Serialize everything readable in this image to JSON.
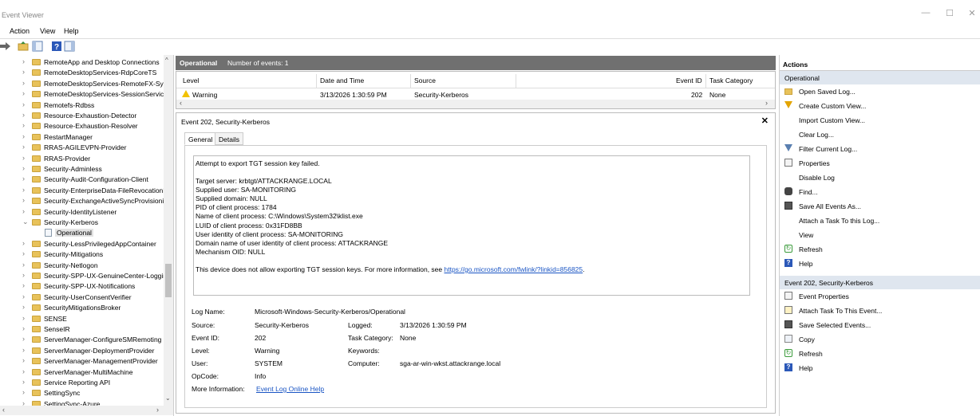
{
  "window": {
    "title": "Event Viewer",
    "minimize": "—",
    "maximize": "☐",
    "close": "✕"
  },
  "menu": {
    "items": [
      "Action",
      "View",
      "Help"
    ]
  },
  "tree": {
    "items": [
      {
        "label": "RemoteApp and Desktop Connections",
        "chev": "›"
      },
      {
        "label": "RemoteDesktopServices-RdpCoreTS",
        "chev": "›"
      },
      {
        "label": "RemoteDesktopServices-RemoteFX-Synth",
        "chev": "›"
      },
      {
        "label": "RemoteDesktopServices-SessionServices",
        "chev": "›"
      },
      {
        "label": "Remotefs-Rdbss",
        "chev": "›"
      },
      {
        "label": "Resource-Exhaustion-Detector",
        "chev": "›"
      },
      {
        "label": "Resource-Exhaustion-Resolver",
        "chev": "›"
      },
      {
        "label": "RestartManager",
        "chev": "›"
      },
      {
        "label": "RRAS-AGILEVPN-Provider",
        "chev": "›"
      },
      {
        "label": "RRAS-Provider",
        "chev": "›"
      },
      {
        "label": "Security-Adminless",
        "chev": "›"
      },
      {
        "label": "Security-Audit-Configuration-Client",
        "chev": "›"
      },
      {
        "label": "Security-EnterpriseData-FileRevocationManager",
        "chev": "›"
      },
      {
        "label": "Security-ExchangeActiveSyncProvisioning",
        "chev": "›"
      },
      {
        "label": "Security-IdentityListener",
        "chev": "›"
      },
      {
        "label": "Security-Kerberos",
        "chev": "⌄"
      },
      {
        "label": "Operational",
        "child": true
      },
      {
        "label": "Security-LessPrivilegedAppContainer",
        "chev": "›"
      },
      {
        "label": "Security-Mitigations",
        "chev": "›"
      },
      {
        "label": "Security-Netlogon",
        "chev": "›"
      },
      {
        "label": "Security-SPP-UX-GenuineCenter-Logging",
        "chev": "›"
      },
      {
        "label": "Security-SPP-UX-Notifications",
        "chev": "›"
      },
      {
        "label": "Security-UserConsentVerifier",
        "chev": "›"
      },
      {
        "label": "SecurityMitigationsBroker",
        "chev": "›"
      },
      {
        "label": "SENSE",
        "chev": "›"
      },
      {
        "label": "SenseIR",
        "chev": "›"
      },
      {
        "label": "ServerManager-ConfigureSMRemoting",
        "chev": "›"
      },
      {
        "label": "ServerManager-DeploymentProvider",
        "chev": "›"
      },
      {
        "label": "ServerManager-ManagementProvider",
        "chev": "›"
      },
      {
        "label": "ServerManager-MultiMachine",
        "chev": "›"
      },
      {
        "label": "Service Reporting API",
        "chev": "›"
      },
      {
        "label": "SettingSync",
        "chev": "›"
      },
      {
        "label": "SettingSync-Azure",
        "chev": "›"
      }
    ]
  },
  "list": {
    "log_name": "Operational",
    "count_text": "Number of events: 1",
    "columns": [
      "Level",
      "Date and Time",
      "Source",
      "Event ID",
      "Task Category"
    ],
    "row": {
      "level": "Warning",
      "datetime": "3/13/2026 1:30:59 PM",
      "source": "Security-Kerberos",
      "event_id": "202",
      "task_category": "None"
    }
  },
  "detail": {
    "title": "Event 202, Security-Kerberos",
    "close": "✕",
    "tabs": [
      "General",
      "Details"
    ],
    "message": {
      "line1": "Attempt to export TGT session key failed.",
      "lines": [
        "Target server: krbtgt/ATTACKRANGE.LOCAL",
        "Supplied user: SA-MONITORING",
        "Supplied domain: NULL",
        "PID of client process: 1784",
        "Name of client process: C:\\Windows\\System32\\klist.exe",
        "LUID of client process: 0x31FD8BB",
        "User identity of client process: SA-MONITORING",
        "Domain name of user identity of client process: ATTACKRANGE",
        "Mechanism OID: NULL"
      ],
      "footer_text": "This device does not allow exporting TGT session keys. For more information, see ",
      "footer_link": "https://go.microsoft.com/fwlink/?linkid=856825",
      "footer_end": "."
    },
    "fields": {
      "log_name_label": "Log Name:",
      "log_name": "Microsoft-Windows-Security-Kerberos/Operational",
      "source_label": "Source:",
      "source": "Security-Kerberos",
      "logged_label": "Logged:",
      "logged": "3/13/2026 1:30:59 PM",
      "event_id_label": "Event ID:",
      "event_id": "202",
      "task_label": "Task Category:",
      "task": "None",
      "level_label": "Level:",
      "level": "Warning",
      "keywords_label": "Keywords:",
      "keywords": "",
      "user_label": "User:",
      "user": "SYSTEM",
      "computer_label": "Computer:",
      "computer": "sga-ar-win-wkst.attackrange.local",
      "opcode_label": "OpCode:",
      "opcode": "Info",
      "more_info_label": "More Information:",
      "more_info_link": "Event Log Online Help"
    }
  },
  "actions": {
    "heading": "Actions",
    "section1": "Operational",
    "items1": [
      {
        "label": "Open Saved Log...",
        "icon": "folder"
      },
      {
        "label": "Create Custom View...",
        "icon": "filter"
      },
      {
        "label": "Import Custom View...",
        "icon": ""
      },
      {
        "label": "Clear Log...",
        "icon": ""
      },
      {
        "label": "Filter Current Log...",
        "icon": "filter2"
      },
      {
        "label": "Properties",
        "icon": "props"
      },
      {
        "label": "Disable Log",
        "icon": ""
      },
      {
        "label": "Find...",
        "icon": "find"
      },
      {
        "label": "Save All Events As...",
        "icon": "save"
      },
      {
        "label": "Attach a Task To this Log...",
        "icon": ""
      },
      {
        "label": "View",
        "icon": ""
      },
      {
        "label": "Refresh",
        "icon": "refresh"
      },
      {
        "label": "Help",
        "icon": "help"
      }
    ],
    "section2": "Event 202, Security-Kerberos",
    "items2": [
      {
        "label": "Event Properties",
        "icon": "props"
      },
      {
        "label": "Attach Task To This Event...",
        "icon": "task"
      },
      {
        "label": "Save Selected Events...",
        "icon": "save"
      },
      {
        "label": "Copy",
        "icon": "copy"
      },
      {
        "label": "Refresh",
        "icon": "refresh"
      },
      {
        "label": "Help",
        "icon": "help"
      }
    ]
  }
}
